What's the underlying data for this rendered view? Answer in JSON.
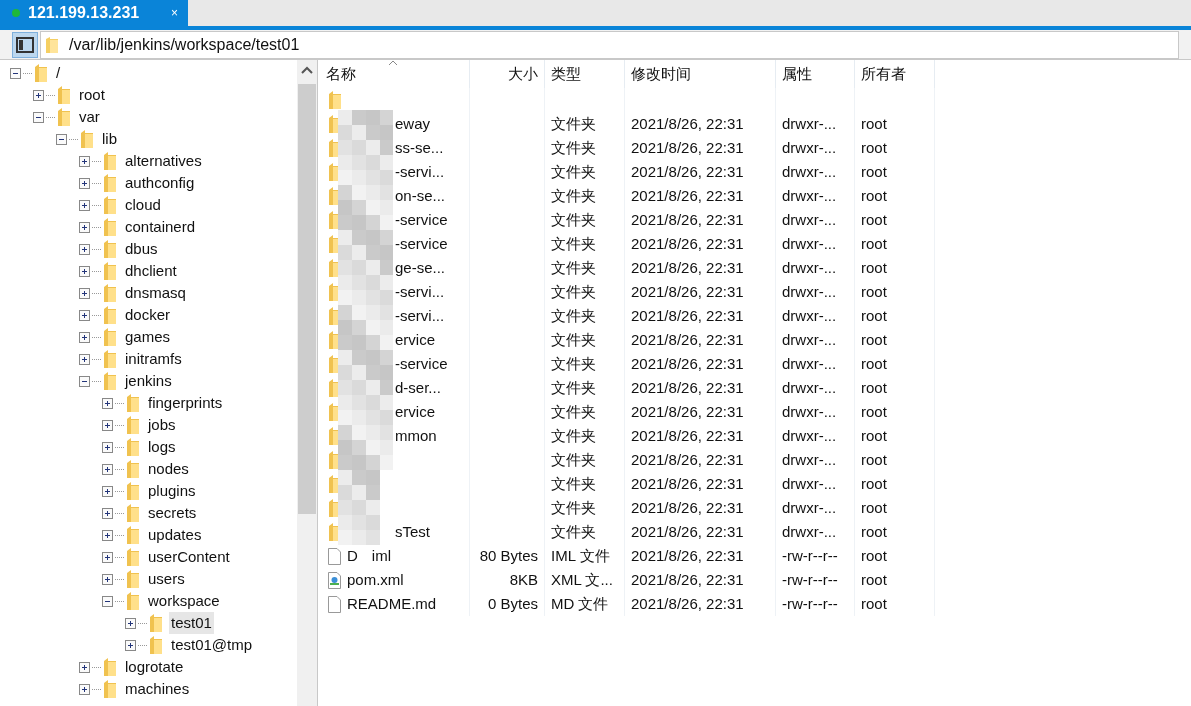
{
  "tabs": [
    {
      "label": "121.199.13.231",
      "selected": true,
      "connected": true,
      "close": "×"
    }
  ],
  "address": {
    "path": "/var/lib/jenkins/workspace/test01"
  },
  "tree": [
    {
      "label": "/",
      "expanded": true,
      "selected": false,
      "children": [
        {
          "label": "root",
          "expanded": false,
          "selected": false
        },
        {
          "label": "var",
          "expanded": true,
          "selected": false,
          "children": [
            {
              "label": "lib",
              "expanded": true,
              "selected": false,
              "children": [
                {
                  "label": "alternatives",
                  "expanded": false,
                  "selected": false
                },
                {
                  "label": "authconfig",
                  "expanded": false,
                  "selected": false
                },
                {
                  "label": "cloud",
                  "expanded": false,
                  "selected": false
                },
                {
                  "label": "containerd",
                  "expanded": false,
                  "selected": false
                },
                {
                  "label": "dbus",
                  "expanded": false,
                  "selected": false
                },
                {
                  "label": "dhclient",
                  "expanded": false,
                  "selected": false
                },
                {
                  "label": "dnsmasq",
                  "expanded": false,
                  "selected": false
                },
                {
                  "label": "docker",
                  "expanded": false,
                  "selected": false
                },
                {
                  "label": "games",
                  "expanded": false,
                  "selected": false
                },
                {
                  "label": "initramfs",
                  "expanded": false,
                  "selected": false
                },
                {
                  "label": "jenkins",
                  "expanded": true,
                  "selected": false,
                  "children": [
                    {
                      "label": "fingerprints",
                      "expanded": false,
                      "selected": false
                    },
                    {
                      "label": "jobs",
                      "expanded": false,
                      "selected": false
                    },
                    {
                      "label": "logs",
                      "expanded": false,
                      "selected": false
                    },
                    {
                      "label": "nodes",
                      "expanded": false,
                      "selected": false
                    },
                    {
                      "label": "plugins",
                      "expanded": false,
                      "selected": false
                    },
                    {
                      "label": "secrets",
                      "expanded": false,
                      "selected": false
                    },
                    {
                      "label": "updates",
                      "expanded": false,
                      "selected": false
                    },
                    {
                      "label": "userContent",
                      "expanded": false,
                      "selected": false
                    },
                    {
                      "label": "users",
                      "expanded": false,
                      "selected": false
                    },
                    {
                      "label": "workspace",
                      "expanded": true,
                      "selected": false,
                      "children": [
                        {
                          "label": "test01",
                          "expanded": false,
                          "selected": true
                        },
                        {
                          "label": "test01@tmp",
                          "expanded": false,
                          "selected": false
                        }
                      ]
                    }
                  ]
                },
                {
                  "label": "logrotate",
                  "expanded": false,
                  "selected": false
                },
                {
                  "label": "machines",
                  "expanded": false,
                  "selected": false
                }
              ]
            }
          ]
        }
      ]
    }
  ],
  "table": {
    "columns": [
      {
        "label": "名称",
        "sorted": true
      },
      {
        "label": "大小",
        "sorted": false
      },
      {
        "label": "类型",
        "sorted": false
      },
      {
        "label": "修改时间",
        "sorted": false
      },
      {
        "label": "属性",
        "sorted": false
      },
      {
        "label": "所有者",
        "sorted": false
      }
    ],
    "rows": [
      {
        "kind": "folder"
      },
      {
        "kind": "folder",
        "name": "eway",
        "type": "文件夹",
        "modified": "2021/8/26, 22:31",
        "attributes": "drwxr-...",
        "owner": "root"
      },
      {
        "kind": "folder",
        "name": "ss-se...",
        "type": "文件夹",
        "modified": "2021/8/26, 22:31",
        "attributes": "drwxr-...",
        "owner": "root"
      },
      {
        "kind": "folder",
        "name": "-servi...",
        "type": "文件夹",
        "modified": "2021/8/26, 22:31",
        "attributes": "drwxr-...",
        "owner": "root"
      },
      {
        "kind": "folder",
        "name": "on-se...",
        "type": "文件夹",
        "modified": "2021/8/26, 22:31",
        "attributes": "drwxr-...",
        "owner": "root"
      },
      {
        "kind": "folder",
        "name": "-service",
        "type": "文件夹",
        "modified": "2021/8/26, 22:31",
        "attributes": "drwxr-...",
        "owner": "root"
      },
      {
        "kind": "folder",
        "name": "-service",
        "type": "文件夹",
        "modified": "2021/8/26, 22:31",
        "attributes": "drwxr-...",
        "owner": "root"
      },
      {
        "kind": "folder",
        "name": "ge-se...",
        "type": "文件夹",
        "modified": "2021/8/26, 22:31",
        "attributes": "drwxr-...",
        "owner": "root"
      },
      {
        "kind": "folder",
        "name": "-servi...",
        "type": "文件夹",
        "modified": "2021/8/26, 22:31",
        "attributes": "drwxr-...",
        "owner": "root"
      },
      {
        "kind": "folder",
        "name": "-servi...",
        "type": "文件夹",
        "modified": "2021/8/26, 22:31",
        "attributes": "drwxr-...",
        "owner": "root"
      },
      {
        "kind": "folder",
        "name": "ervice",
        "type": "文件夹",
        "modified": "2021/8/26, 22:31",
        "attributes": "drwxr-...",
        "owner": "root"
      },
      {
        "kind": "folder",
        "name": "-service",
        "type": "文件夹",
        "modified": "2021/8/26, 22:31",
        "attributes": "drwxr-...",
        "owner": "root"
      },
      {
        "kind": "folder",
        "name": "d-ser...",
        "type": "文件夹",
        "modified": "2021/8/26, 22:31",
        "attributes": "drwxr-...",
        "owner": "root"
      },
      {
        "kind": "folder",
        "name": "ervice",
        "type": "文件夹",
        "modified": "2021/8/26, 22:31",
        "attributes": "drwxr-...",
        "owner": "root"
      },
      {
        "kind": "folder",
        "name": "mmon",
        "type": "文件夹",
        "modified": "2021/8/26, 22:31",
        "attributes": "drwxr-...",
        "owner": "root"
      },
      {
        "kind": "folder",
        "type": "文件夹",
        "modified": "2021/8/26, 22:31",
        "attributes": "drwxr-...",
        "owner": "root"
      },
      {
        "kind": "folder",
        "type": "文件夹",
        "modified": "2021/8/26, 22:31",
        "attributes": "drwxr-...",
        "owner": "root"
      },
      {
        "kind": "folder",
        "type": "文件夹",
        "modified": "2021/8/26, 22:31",
        "attributes": "drwxr-...",
        "owner": "root"
      },
      {
        "kind": "folder",
        "name": "sTest",
        "type": "文件夹",
        "modified": "2021/8/26, 22:31",
        "attributes": "drwxr-...",
        "owner": "root"
      },
      {
        "kind": "file",
        "name": "D",
        "name_tail": "iml",
        "size": "80 Bytes",
        "type": "IML 文件",
        "modified": "2021/8/26, 22:31",
        "attributes": "-rw-r--r--",
        "owner": "root"
      },
      {
        "kind": "xml",
        "name": "pom.xml",
        "size": "8KB",
        "type": "XML 文...",
        "modified": "2021/8/26, 22:31",
        "attributes": "-rw-r--r--",
        "owner": "root"
      },
      {
        "kind": "file",
        "name": "README.md",
        "size": "0 Bytes",
        "type": "MD 文件",
        "modified": "2021/8/26, 22:31",
        "attributes": "-rw-r--r--",
        "owner": "root"
      }
    ]
  }
}
